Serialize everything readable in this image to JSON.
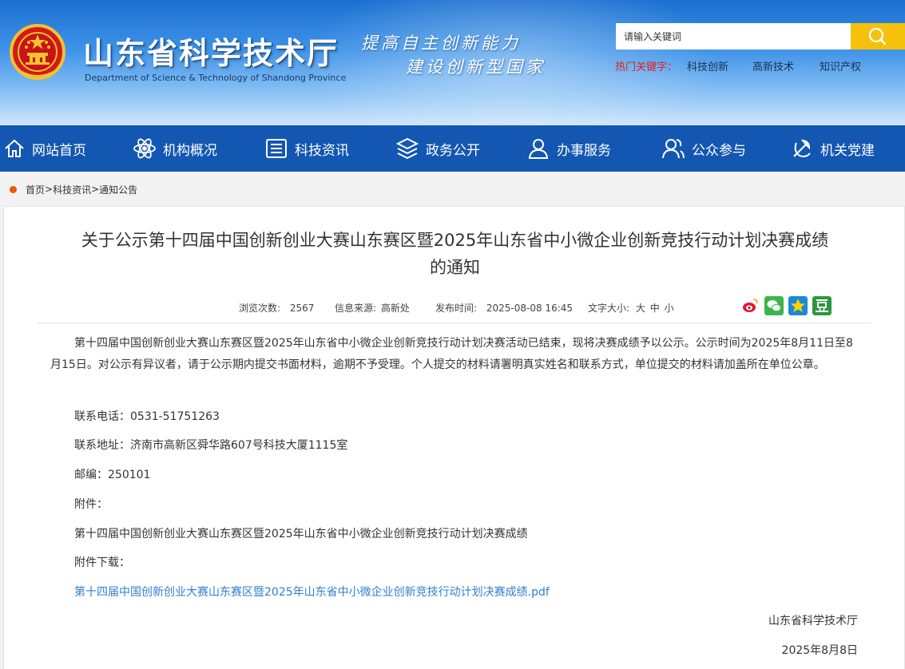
{
  "header": {
    "site_title": "山东省科学技术厅",
    "site_subtitle": "Department of Science & Technology of Shandong Province",
    "slogan_line1": "提高自主创新能力",
    "slogan_line2": "建设创新型国家",
    "search_placeholder": "请输入关键词",
    "hot_label": "热门关键字：",
    "hot_keywords": [
      "科技创新",
      "高新技术",
      "知识产权"
    ]
  },
  "nav": {
    "items": [
      {
        "label": "网站首页",
        "icon": "home-icon"
      },
      {
        "label": "机构概况",
        "icon": "atom-icon"
      },
      {
        "label": "科技资讯",
        "icon": "news-icon"
      },
      {
        "label": "政务公开",
        "icon": "layers-icon"
      },
      {
        "label": "办事服务",
        "icon": "user-service-icon"
      },
      {
        "label": "公众参与",
        "icon": "people-icon"
      },
      {
        "label": "机关党建",
        "icon": "party-icon"
      }
    ]
  },
  "breadcrumb": {
    "items": [
      "首页",
      "科技资讯",
      "通知公告"
    ],
    "separator": ">"
  },
  "article": {
    "title_line1": "关于公示第十四届中国创新创业大赛山东赛区暨2025年山东省中小微企业创新竞技行动计划决赛成绩",
    "title_line2": "的通知",
    "views_label": "浏览次数:",
    "views_value": "2567",
    "source_label": "信息来源:",
    "source_value": "高新处",
    "time_label": "发布时间:",
    "time_value": "2025-08-08 16:45",
    "fontsize_label": "文字大小:",
    "font_large": "大",
    "font_medium": "中",
    "font_small": "小",
    "share_icons": [
      "weibo-icon",
      "wechat-icon",
      "qzone-icon",
      "douban-icon"
    ],
    "paragraph": "第十四届中国创新创业大赛山东赛区暨2025年山东省中小微企业创新竞技行动计划决赛活动已结束，现将决赛成绩予以公示。公示时间为2025年8月11日至8月15日。对公示有异议者，请于公示期内提交书面材料，逾期不予受理。个人提交的材料请署明真实姓名和联系方式，单位提交的材料请加盖所在单位公章。",
    "phone": "联系电话：0531-51751263",
    "address": "联系地址：济南市高新区舜华路607号科技大厦1115室",
    "postcode": "邮编：250101",
    "attachment_label": "附件：",
    "attachment_name": "第十四届中国创新创业大赛山东赛区暨2025年山东省中小微企业创新竞技行动计划决赛成绩",
    "download_label": "附件下载：",
    "download_link": "第十四届中国创新创业大赛山东赛区暨2025年山东省中小微企业创新竞技行动计划决赛成绩.pdf",
    "signature": "山东省科学技术厅",
    "date": "2025年8月8日"
  },
  "colors": {
    "nav_bg": "#1457b2",
    "search_btn": "#f5c10a",
    "hot_label": "#e0201a",
    "link": "#2f7fd1",
    "crumb_dot": "#e65c00"
  }
}
